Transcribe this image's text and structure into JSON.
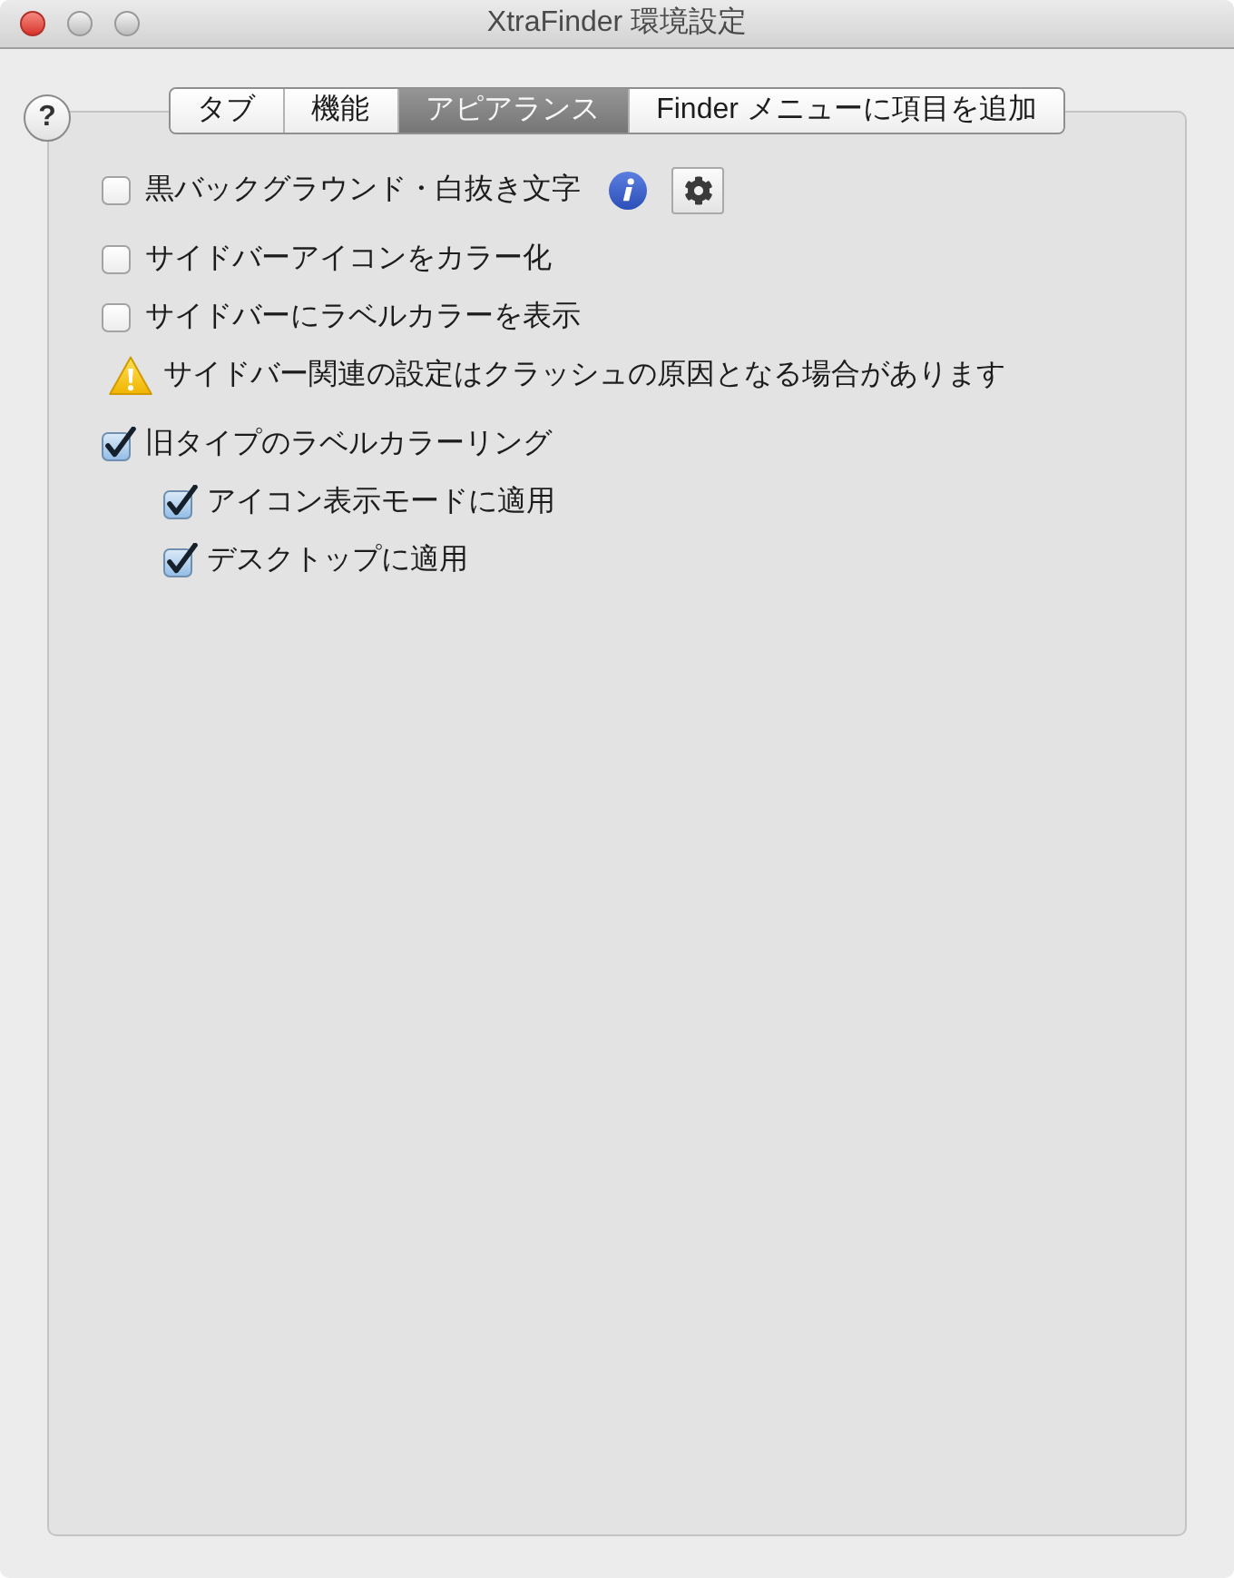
{
  "window": {
    "title": "XtraFinder 環境設定"
  },
  "help_button": {
    "label": "?"
  },
  "tabs": [
    {
      "label": "タブ",
      "selected": false
    },
    {
      "label": "機能",
      "selected": false
    },
    {
      "label": "アピアランス",
      "selected": true
    },
    {
      "label": "Finder メニューに項目を追加",
      "selected": false
    }
  ],
  "options": [
    {
      "kind": "checkbox_with_settings",
      "label": "黒バックグラウンド・白抜き文字",
      "checked": false
    },
    {
      "kind": "checkbox",
      "label": "サイドバーアイコンをカラー化",
      "checked": false
    },
    {
      "kind": "checkbox",
      "label": "サイドバーにラベルカラーを表示",
      "checked": false
    },
    {
      "kind": "warning",
      "label": "サイドバー関連の設定はクラッシュの原因となる場合があります"
    },
    {
      "kind": "checkbox",
      "label": "旧タイプのラベルカラーリング",
      "checked": true,
      "children": [
        {
          "kind": "checkbox",
          "label": "アイコン表示モードに適用",
          "checked": true
        },
        {
          "kind": "checkbox",
          "label": "デスクトップに適用",
          "checked": true
        }
      ]
    }
  ]
}
